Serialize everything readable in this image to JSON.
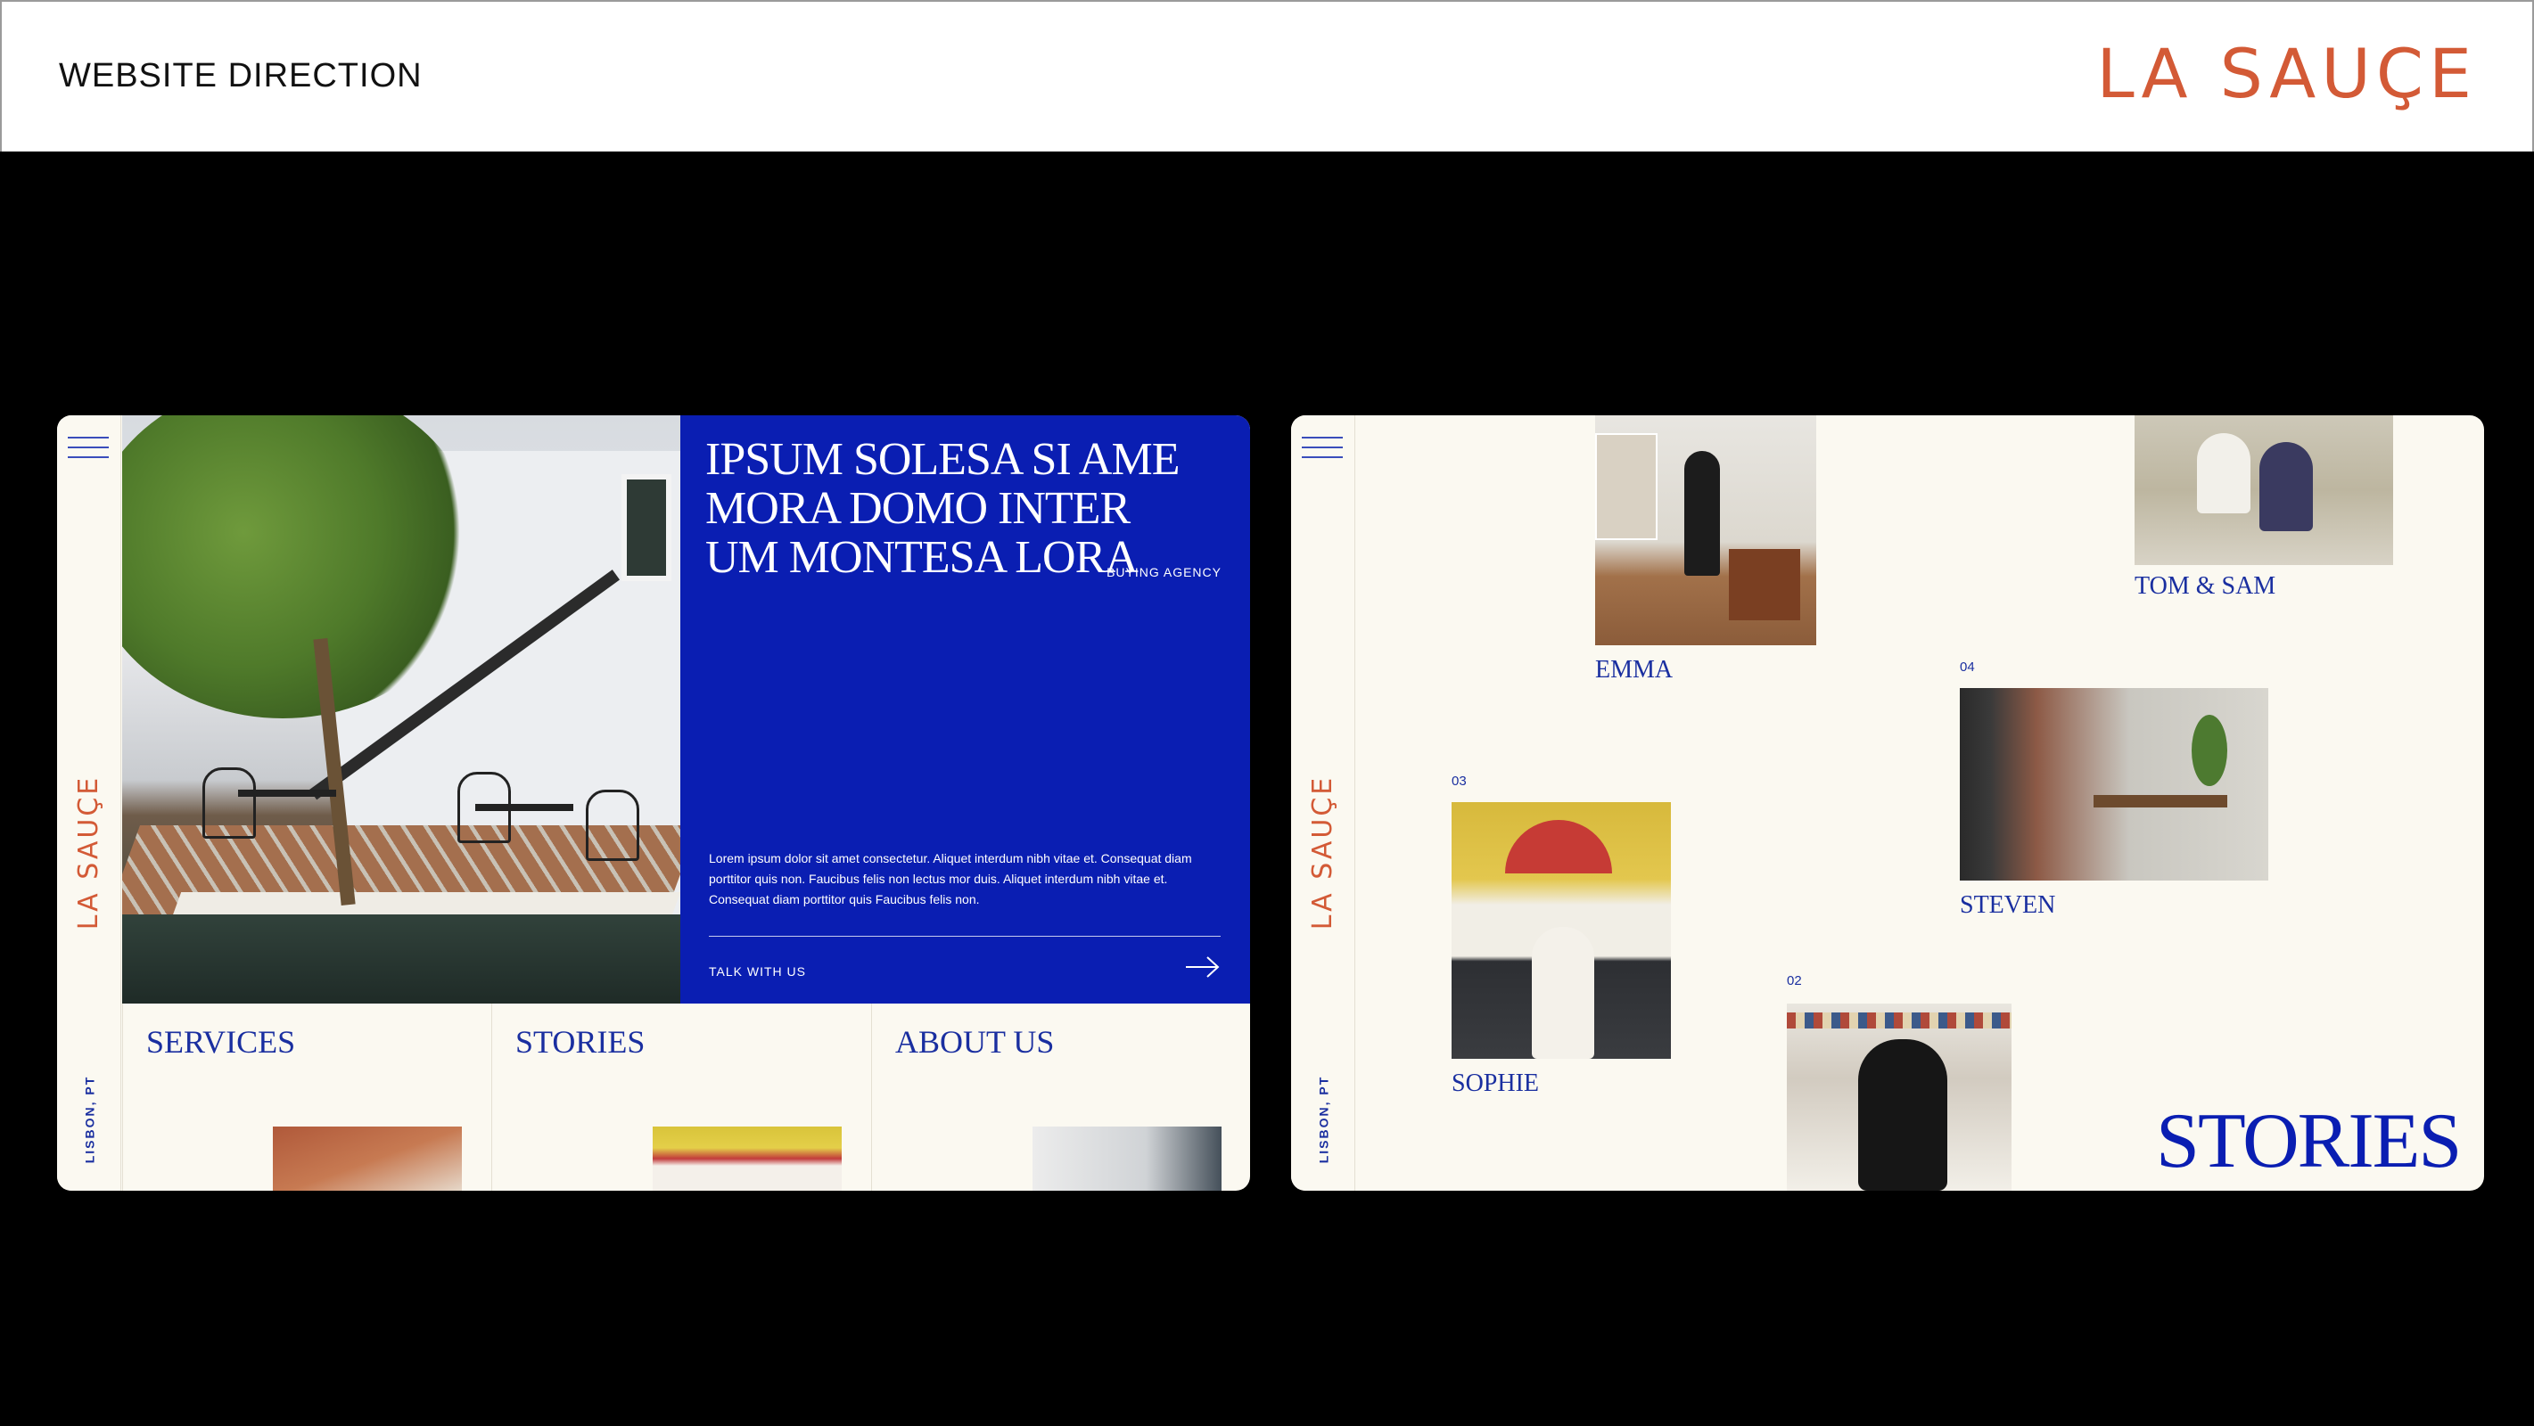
{
  "header": {
    "title": "WEBSITE DIRECTION",
    "brand": "LA SAUÇE"
  },
  "site": {
    "brand_vertical": "LA SAUÇE",
    "location": "LISBON, PT"
  },
  "hero": {
    "headline": "IPSUM SOLESA SI AME MORA DOMO INTER UM MONTESA LORA",
    "tag": "BUYING AGENCY",
    "body": "Lorem ipsum dolor sit amet consectetur. Aliquet interdum nibh vitae et. Consequat diam porttitor quis non. Faucibus felis non lectus mor duis.  Aliquet interdum nibh vitae et. Consequat diam porttitor quis  Faucibus felis non.",
    "cta": "TALK WITH US"
  },
  "nav": [
    {
      "label": "SERVICES"
    },
    {
      "label": "STORIES"
    },
    {
      "label": "ABOUT US"
    }
  ],
  "stories": {
    "title": "STORIES",
    "items": [
      {
        "name": "EMMA",
        "num": ""
      },
      {
        "name": "TOM & SAM",
        "num": ""
      },
      {
        "name": "STEVEN",
        "num": "04"
      },
      {
        "name": "SOPHIE",
        "num": "03"
      },
      {
        "name": "",
        "num": "02"
      }
    ]
  },
  "colors": {
    "brand_orange": "#d35a36",
    "brand_blue": "#0a1eb2",
    "paper": "#fbf9f1"
  },
  "icons": [
    "hamburger-icon",
    "arrow-right-icon"
  ]
}
